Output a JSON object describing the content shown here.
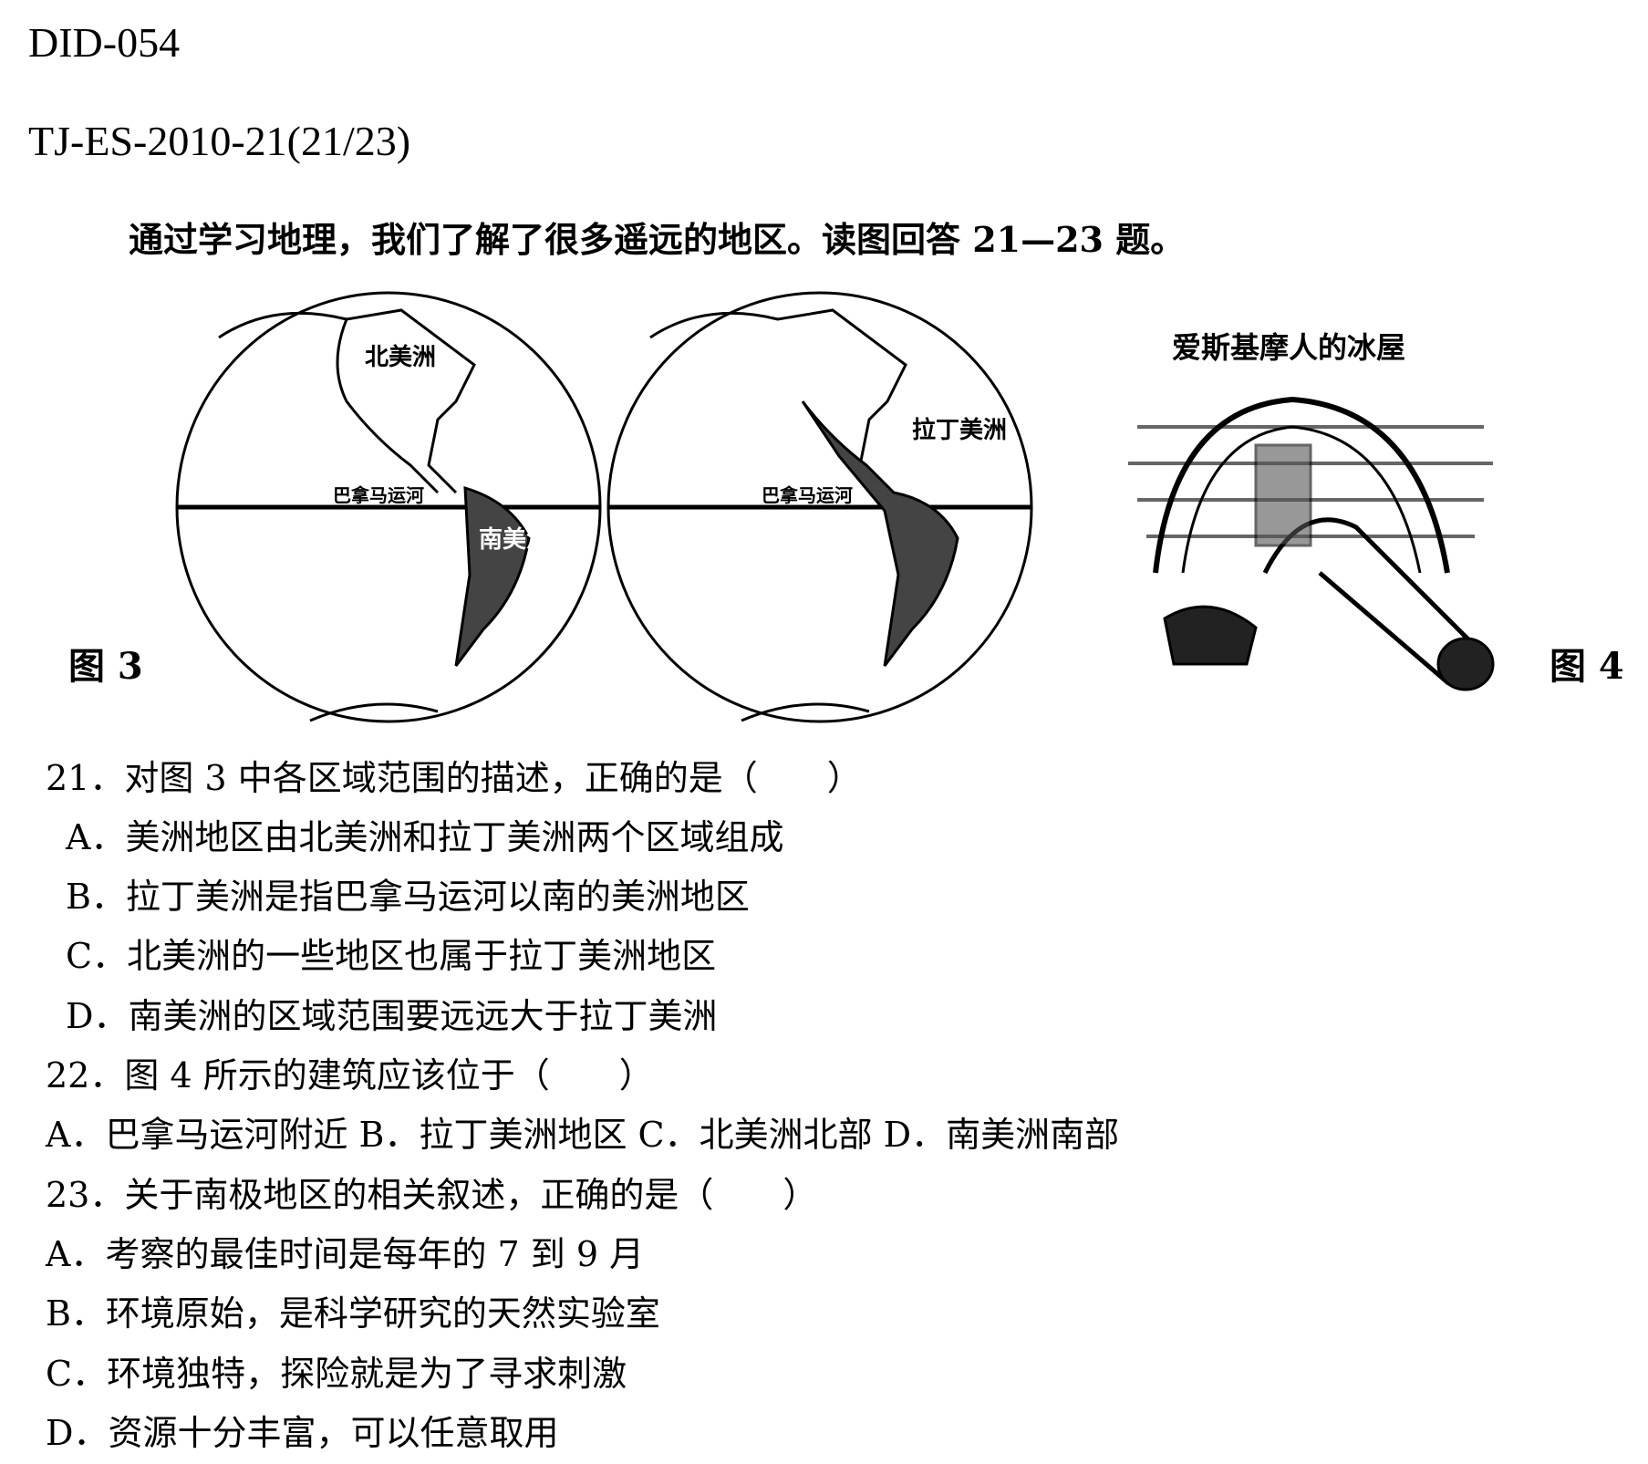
{
  "header": {
    "id": "DID-054",
    "source": "TJ-ES-2010-21(21/23)"
  },
  "intro": "通过学习地理，我们了解了很多遥远的地区。读图回答 21—23 题。",
  "figure3": {
    "label": "图 3",
    "map_labels": {
      "north_america": "北美洲",
      "south_america": "南美洲",
      "latin_america": "拉丁美洲",
      "panama_canal": "巴拿马运河"
    }
  },
  "figure4": {
    "label": "图 4",
    "caption": "爱斯基摩人的冰屋"
  },
  "questions": [
    {
      "stem": "21．对图 3 中各区域范围的描述，正确的是（　　）",
      "options": [
        "A．美洲地区由北美洲和拉丁美洲两个区域组成",
        "B．拉丁美洲是指巴拿马运河以南的美洲地区",
        "C．北美洲的一些地区也属于拉丁美洲地区",
        "D．南美洲的区域范围要远远大于拉丁美洲"
      ]
    },
    {
      "stem": "22．图 4 所示的建筑应该位于（　　）",
      "options": [
        "A．巴拿马运河附近 B．拉丁美洲地区 C．北美洲北部 D．南美洲南部"
      ]
    },
    {
      "stem": "23．关于南极地区的相关叙述，正确的是（　　）",
      "options": [
        "A．考察的最佳时间是每年的 7 到 9 月",
        "B．环境原始，是科学研究的天然实验室",
        "C．环境独特，探险就是为了寻求刺激",
        "D．资源十分丰富，可以任意取用"
      ]
    }
  ]
}
